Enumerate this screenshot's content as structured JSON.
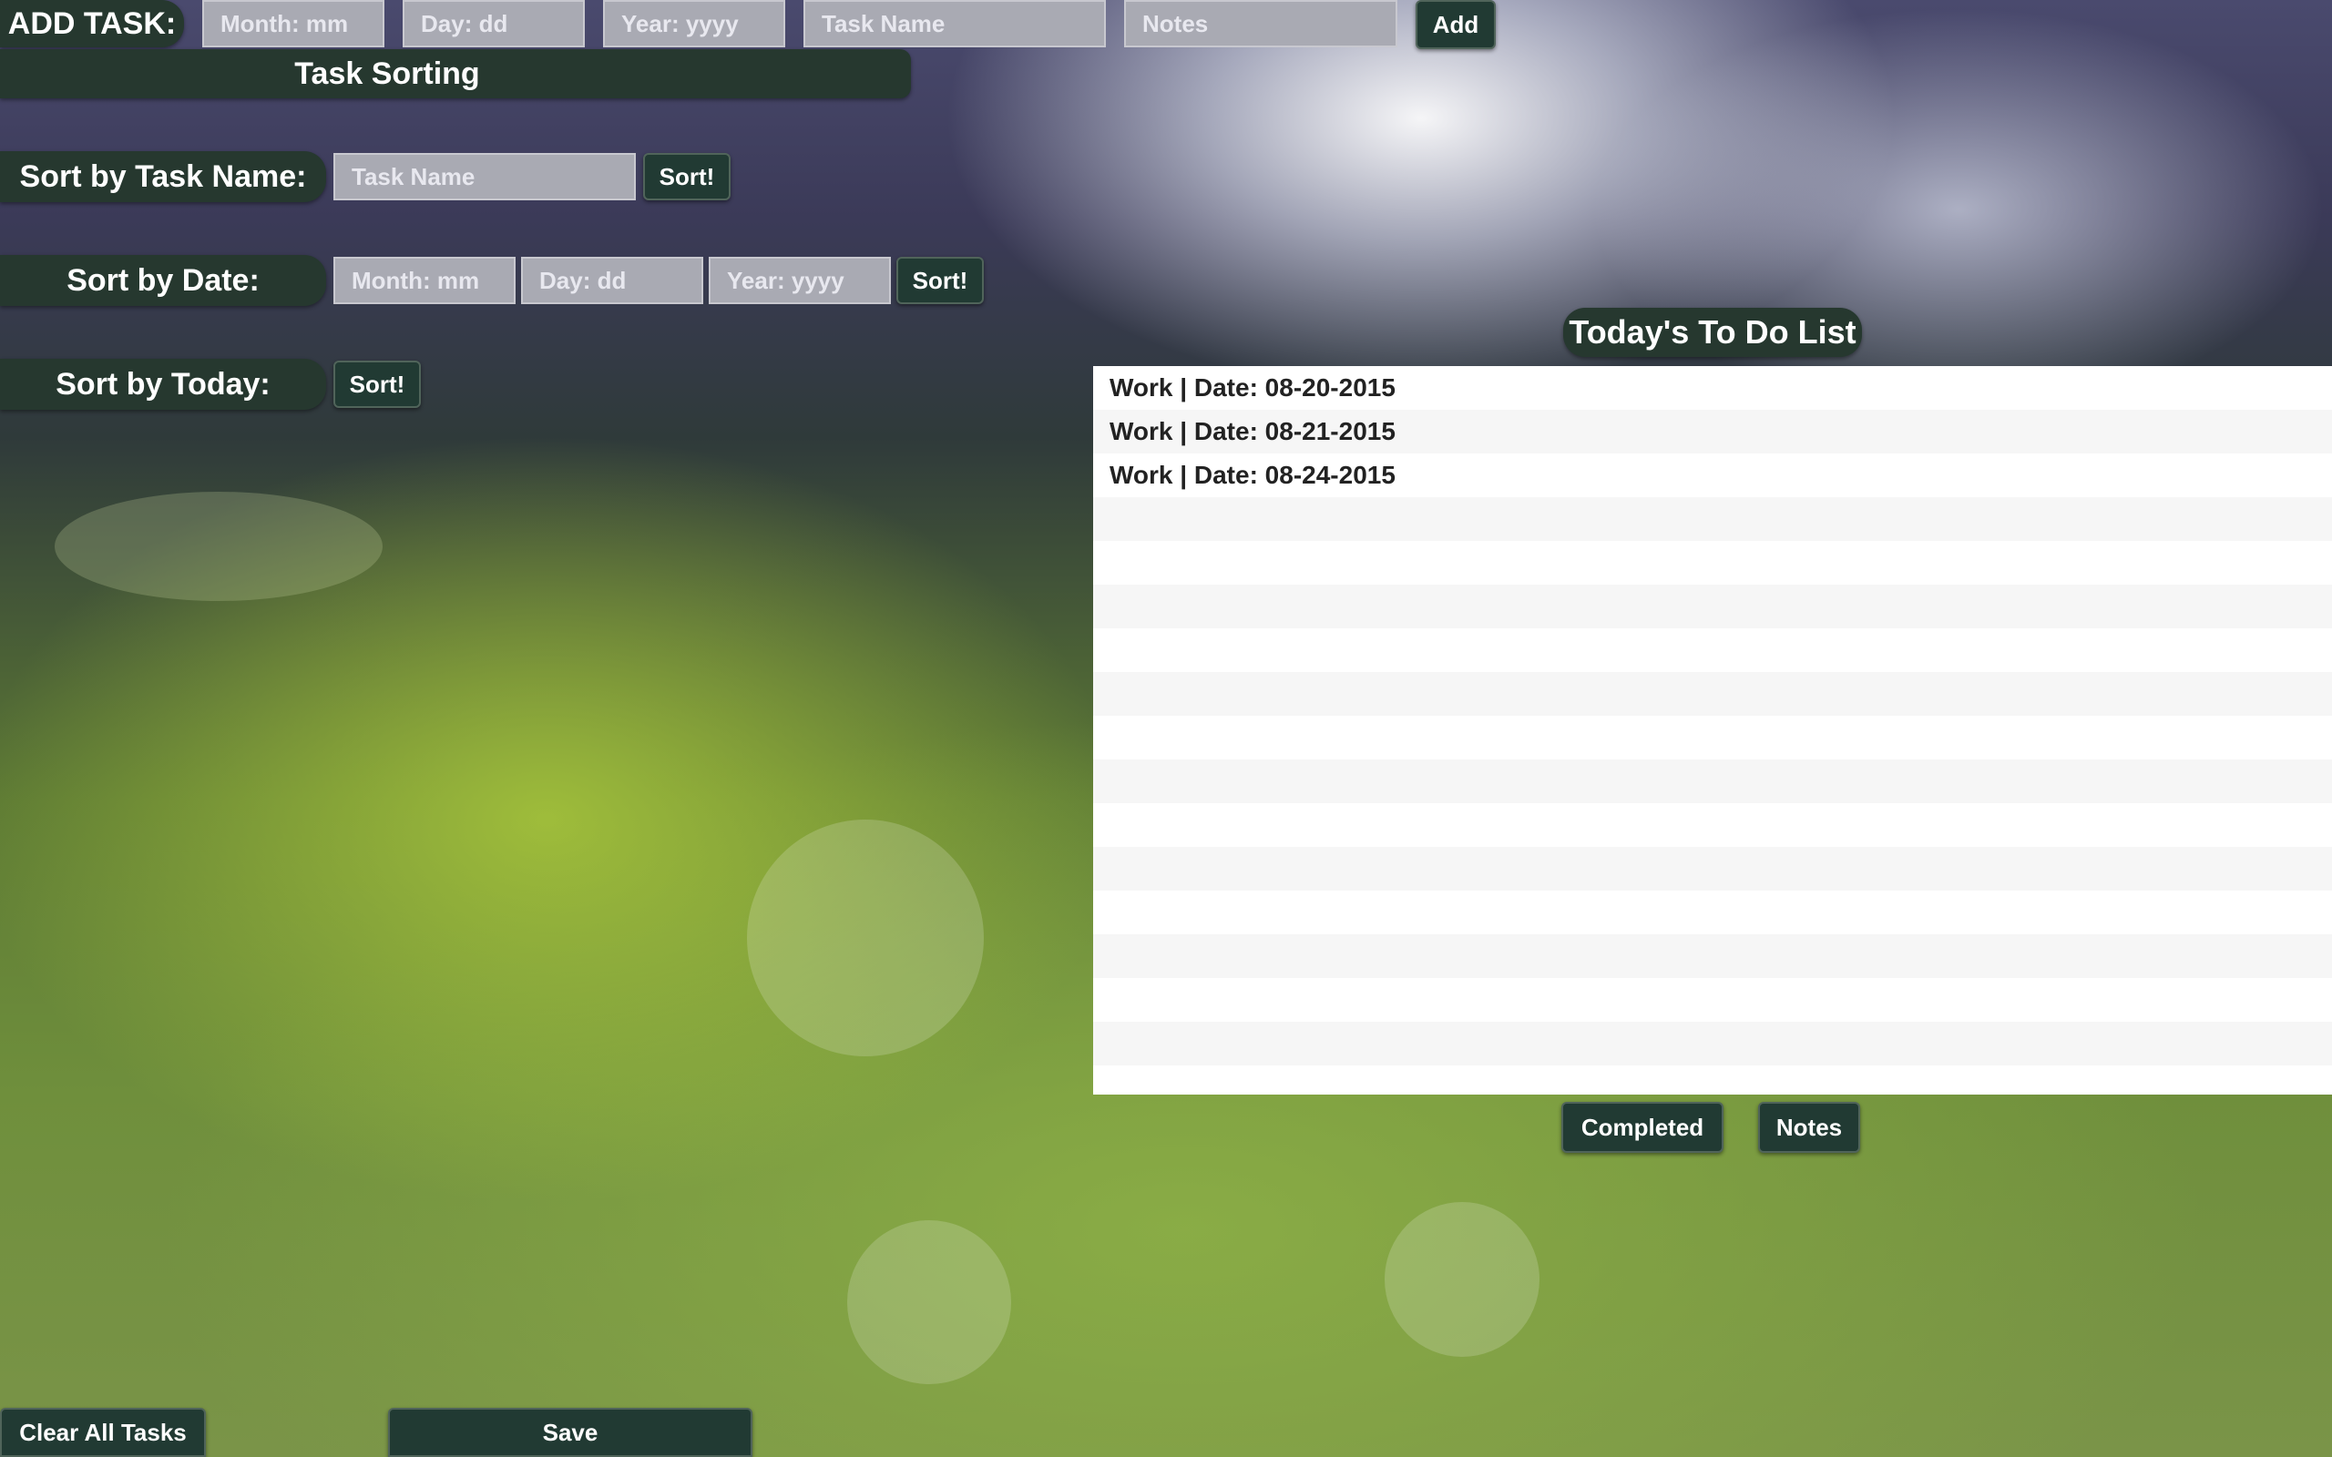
{
  "add_task": {
    "label": "ADD TASK:",
    "month_placeholder": "Month: mm",
    "day_placeholder": "Day: dd",
    "year_placeholder": "Year: yyyy",
    "task_name_placeholder": "Task Name",
    "notes_placeholder": "Notes",
    "add_label": "Add"
  },
  "sorting": {
    "header": "Task Sorting",
    "by_name": {
      "label": "Sort by Task Name:",
      "placeholder": "Task Name",
      "button": "Sort!"
    },
    "by_date": {
      "label": "Sort by Date:",
      "month_placeholder": "Month: mm",
      "day_placeholder": "Day: dd",
      "year_placeholder": "Year: yyyy",
      "button": "Sort!"
    },
    "by_today": {
      "label": "Sort by Today:",
      "button": "Sort!"
    }
  },
  "todo": {
    "title": "Today's To Do List",
    "items": [
      "Work | Date: 08-20-2015",
      "Work | Date: 08-21-2015",
      "Work | Date: 08-24-2015",
      "",
      "",
      "",
      "",
      "",
      "",
      "",
      "",
      "",
      "",
      "",
      "",
      "",
      ""
    ],
    "completed_label": "Completed",
    "notes_label": "Notes"
  },
  "footer": {
    "clear_label": "Clear All Tasks",
    "save_label": "Save"
  }
}
